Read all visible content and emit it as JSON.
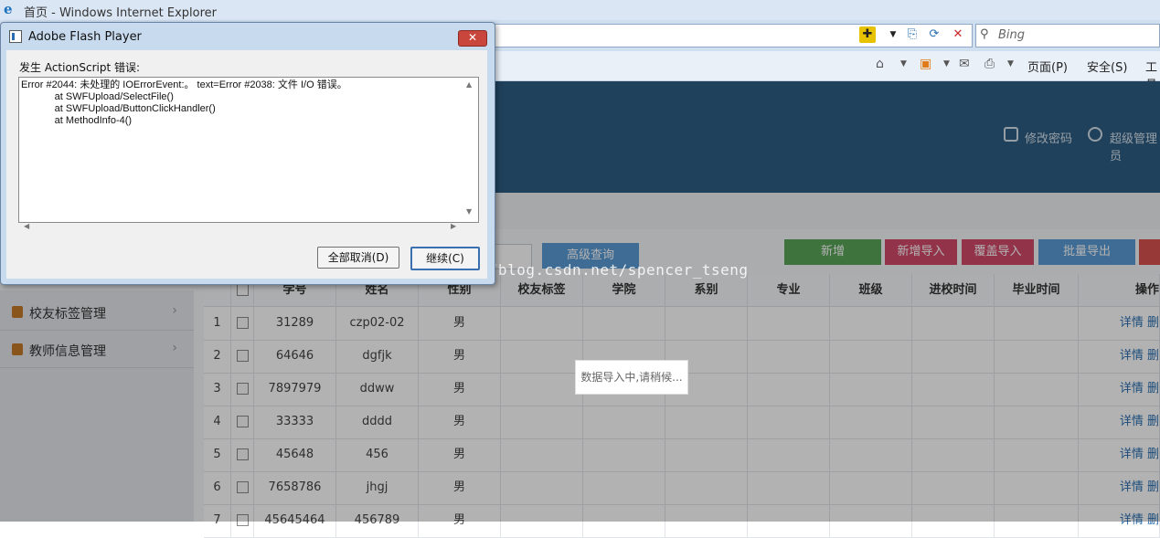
{
  "browser": {
    "window_title": "首页 - Windows Internet Explorer",
    "search_placeholder": "Bing",
    "menu_page": "页面(P)",
    "menu_safety": "安全(S)",
    "menu_tools": "工具"
  },
  "header": {
    "change_password": "修改密码",
    "user": "超级管理员"
  },
  "toolbar": {
    "advanced_search": "高级查询",
    "add": "新增",
    "add_import": "新增导入",
    "update_import": "覆盖导入",
    "batch_export": "批量导出"
  },
  "sidebar": {
    "items": [
      {
        "label": "校友标签管理"
      },
      {
        "label": "教师信息管理"
      }
    ]
  },
  "table": {
    "headers": [
      "",
      "",
      "学号",
      "姓名",
      "性别",
      "校友标签",
      "学院",
      "系别",
      "专业",
      "班级",
      "进校时间",
      "毕业时间",
      "操作"
    ],
    "action_label": "详情 删",
    "rows": [
      {
        "idx": "1",
        "id": "31289",
        "name": "czp02-02",
        "gender": "男"
      },
      {
        "idx": "2",
        "id": "64646",
        "name": "dgfjk",
        "gender": "男"
      },
      {
        "idx": "3",
        "id": "7897979",
        "name": "ddww",
        "gender": "男"
      },
      {
        "idx": "4",
        "id": "33333",
        "name": "dddd",
        "gender": "男"
      },
      {
        "idx": "5",
        "id": "45648",
        "name": "456",
        "gender": "男"
      },
      {
        "idx": "6",
        "id": "7658786",
        "name": "jhgj",
        "gender": "男"
      },
      {
        "idx": "7",
        "id": "45645464",
        "name": "456789",
        "gender": "男"
      }
    ]
  },
  "loading": {
    "text": "数据导入中,请稍候..."
  },
  "watermark": "http://blog.csdn.net/spencer_tseng",
  "dialog": {
    "title": "Adobe Flash Player",
    "heading": "发生 ActionScript 错误:",
    "error_text": "Error #2044: 未处理的 IOErrorEvent:。 text=Error #2038: 文件 I/O 错误。\n            at SWFUpload/SelectFile()\n            at SWFUpload/ButtonClickHandler()\n            at MethodInfo-4()",
    "dismiss_all": "全部取消(D)",
    "continue": "继续(C)",
    "close_symbol": "✕"
  },
  "colors": {
    "header_bg": "#2f5d83",
    "btn_green": "#5aa55a",
    "btn_pink": "#d2496a",
    "btn_blue": "#5b9bd5",
    "btn_red": "#d9534f"
  }
}
